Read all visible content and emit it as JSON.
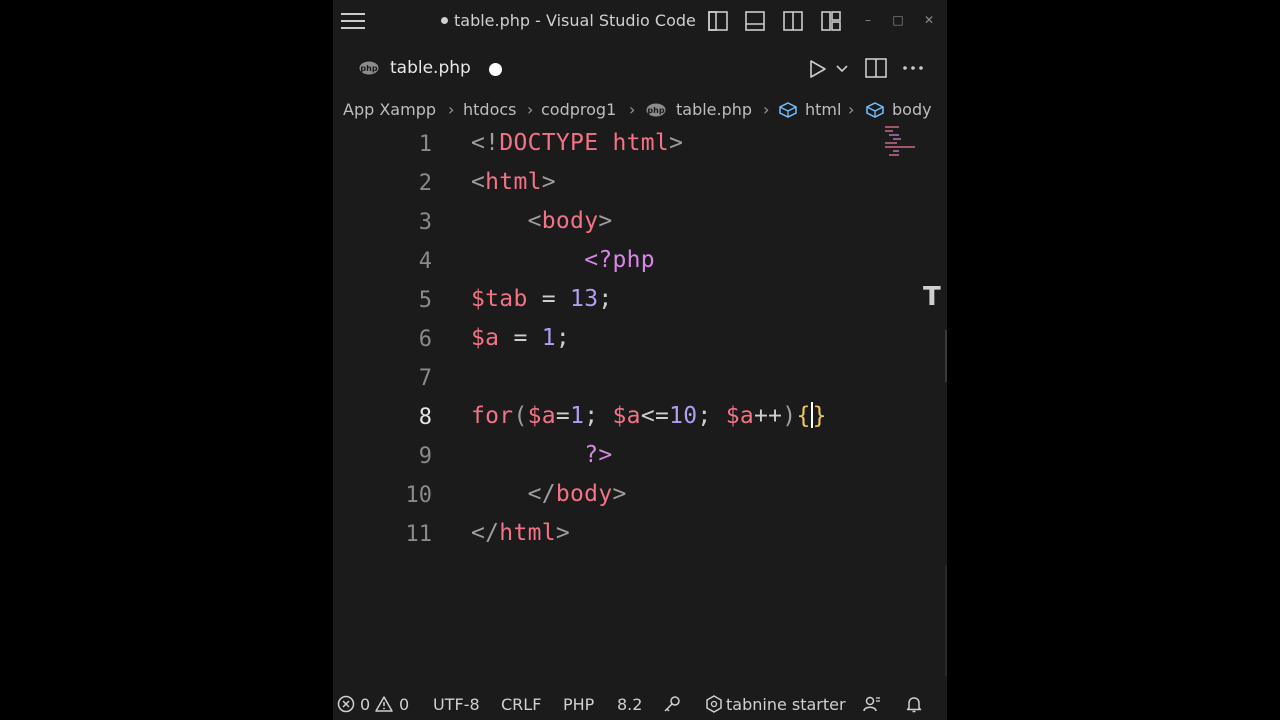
{
  "window": {
    "title": "table.php - Visual Studio Code"
  },
  "tab": {
    "label": "table.php"
  },
  "breadcrumb": [
    "App Xampp",
    "htdocs",
    "codprog1",
    "table.php",
    "html",
    "body"
  ],
  "editor": {
    "active_line": 8,
    "lines": [
      {
        "n": "1"
      },
      {
        "n": "2"
      },
      {
        "n": "3"
      },
      {
        "n": "4"
      },
      {
        "n": "5"
      },
      {
        "n": "6"
      },
      {
        "n": "7"
      },
      {
        "n": "8"
      },
      {
        "n": "9"
      },
      {
        "n": "10"
      },
      {
        "n": "11"
      }
    ],
    "code": {
      "l1_open": "<",
      "l1_bang": "!",
      "l1_doctype": "DOCTYPE",
      "l1_html": " html",
      "l1_close": ">",
      "l2_open": "<",
      "l2_tag": "html",
      "l2_close": ">",
      "l3_indent": "    ",
      "l3_open": "<",
      "l3_tag": "body",
      "l3_close": ">",
      "l4_indent": "        ",
      "l4_php": "<?php",
      "l5_var": "$tab",
      "l5_eq": " = ",
      "l5_num": "13",
      "l5_semi": ";",
      "l6_var": "$a",
      "l6_eq": " = ",
      "l6_num": "1",
      "l6_semi": ";",
      "l8_for": "for",
      "l8_paren": "(",
      "l8_v1": "$a",
      "l8_eq": "=",
      "l8_n1": "1",
      "l8_semi1": "; ",
      "l8_v2": "$a",
      "l8_le": "<=",
      "l8_n2": "10",
      "l8_semi2": "; ",
      "l8_v3": "$a",
      "l8_inc": "++",
      "l8_close": ")",
      "l8_brace_open": "{",
      "l8_brace_close": "}",
      "l9_indent": "        ",
      "l9_php_close": "?>",
      "l10_indent": "    ",
      "l10_open": "</",
      "l10_tag": "body",
      "l10_close": ">",
      "l11_open": "</",
      "l11_tag": "html",
      "l11_close": ">"
    }
  },
  "statusbar": {
    "errors": "0",
    "warnings": "0",
    "encoding": "UTF-8",
    "eol": "CRLF",
    "language": "PHP",
    "version": "8.2",
    "tabnine": "tabnine starter"
  },
  "overlay": {
    "tabnine_glyph": "T"
  },
  "colors": {
    "background": "#1b1b1b",
    "tag": "#f47286",
    "php": "#d886e6",
    "number": "#b39df3",
    "brace": "#f0c860"
  }
}
